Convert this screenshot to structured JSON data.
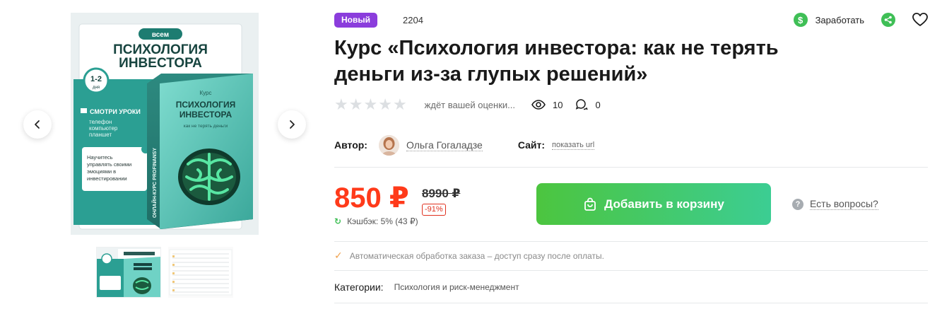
{
  "gallery": {
    "cover": {
      "tag": "всем",
      "title_line1": "ПСИХОЛОГИЯ",
      "title_line2": "ИНВЕСТОРА",
      "days_number": "1-2",
      "days_word": "дня",
      "watch_heading": "СМОТРИ УРОКИ",
      "devices": [
        "телефон",
        "компьютер",
        "планшет"
      ],
      "learn_text": [
        "Научитесь",
        "управлять своими",
        "эмоциями в",
        "инвестировании"
      ],
      "box_kind": "Курс",
      "box_title_line1": "ПСИХОЛОГИЯ",
      "box_title_line2": "ИНВЕСТОРА",
      "box_subtitle": "как не терять деньги",
      "box_side": "ОНЛАЙН-КУРС PROFINANSY"
    }
  },
  "badge": "Новый",
  "product_id": "2204",
  "actions": {
    "earn_label": "Заработать",
    "earn_symbol": "$"
  },
  "title": "Курс «Психология инвестора: как не терять деньги из-за глупых решений»",
  "rating": {
    "stars": 5,
    "star_glyph": "★",
    "text": "ждёт вашей оценки...",
    "views": "10",
    "comments": "0"
  },
  "author": {
    "label": "Автор:",
    "name": "Ольга Гогаладзе",
    "site_label": "Сайт:",
    "site_link": "показать url"
  },
  "pricing": {
    "price": "850 ₽",
    "old_price": "8990 ₽",
    "discount": "-91%",
    "cashback": "Кэшбэк: 5% (43 ₽)",
    "cashback_symbol": "↻"
  },
  "cart": {
    "label": "Добавить в корзину"
  },
  "ask": {
    "symbol": "?",
    "label": "Есть вопросы?"
  },
  "auto": {
    "symbol": "✓",
    "text": "Автоматическая обработка заказа – доступ сразу после оплаты."
  },
  "category": {
    "label": "Категории:",
    "value": "Психология и риск-менеджмент"
  },
  "colors": {
    "badge": "#8b3ddc",
    "price": "#ff3a1a",
    "cart_from": "#4cc53f",
    "cart_to": "#3ccd93",
    "accent_green": "#3fbf56"
  }
}
